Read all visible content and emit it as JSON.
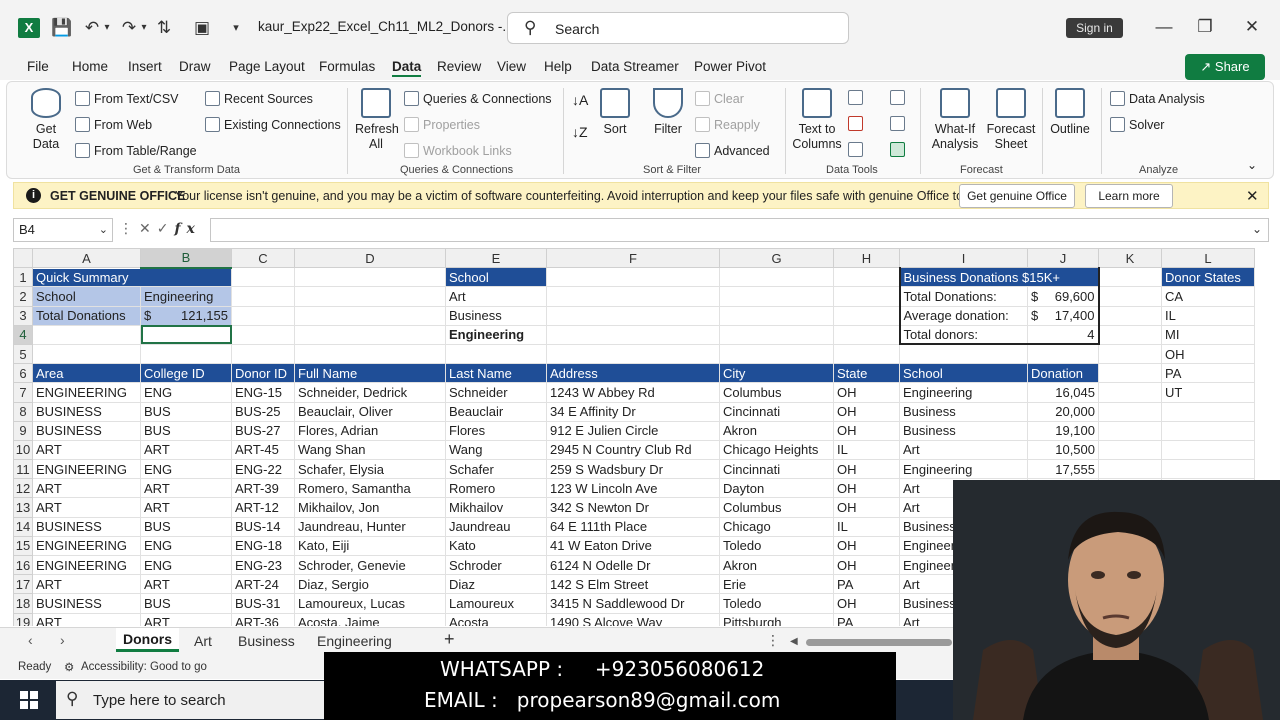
{
  "titlebar": {
    "doc_title": "kaur_Exp22_Excel_Ch11_ML2_Donors  -...",
    "search_label": "Search",
    "signin_label": "Sign in",
    "logo_letter": "X"
  },
  "menu": {
    "tabs": [
      "File",
      "Home",
      "Insert",
      "Draw",
      "Page Layout",
      "Formulas",
      "Data",
      "Review",
      "View",
      "Help",
      "Data Streamer",
      "Power Pivot"
    ],
    "active": "Data",
    "share_label": "Share"
  },
  "ribbon": {
    "get_data": "Get\nData",
    "from_text_csv": "From Text/CSV",
    "from_web": "From Web",
    "from_table_range": "From Table/Range",
    "recent_sources": "Recent Sources",
    "existing_connections": "Existing Connections",
    "group_get_transform": "Get & Transform Data",
    "refresh_all": "Refresh\nAll",
    "queries_connections": "Queries & Connections",
    "properties": "Properties",
    "workbook_links": "Workbook Links",
    "group_queries": "Queries & Connections",
    "sort": "Sort",
    "filter": "Filter",
    "clear": "Clear",
    "reapply": "Reapply",
    "advanced": "Advanced",
    "group_sort_filter": "Sort & Filter",
    "text_to_columns": "Text to\nColumns",
    "group_data_tools": "Data Tools",
    "what_if": "What-If\nAnalysis",
    "forecast_sheet": "Forecast\nSheet",
    "group_forecast": "Forecast",
    "outline": "Outline",
    "data_analysis": "Data Analysis",
    "solver": "Solver",
    "group_analyze": "Analyze"
  },
  "banner": {
    "head": "GET GENUINE OFFICE",
    "message": "Your license isn't genuine, and you may be a victim of software counterfeiting. Avoid interruption and keep your files safe with genuine Office today.",
    "btn_genuine": "Get genuine Office",
    "btn_learn": "Learn more"
  },
  "formula_bar": {
    "name_box": "B4",
    "formula": ""
  },
  "grid": {
    "columns": [
      "A",
      "B",
      "C",
      "D",
      "E",
      "F",
      "G",
      "H",
      "I",
      "J",
      "K",
      "L"
    ],
    "summary": {
      "title": "Quick Summary",
      "school_label": "School",
      "school_value": "Engineering",
      "total_label": "Total Donations",
      "total_currency": "$",
      "total_value": "121,155"
    },
    "school_list": {
      "header": "School",
      "items": [
        "Art",
        "Business",
        "Engineering"
      ]
    },
    "business_box": {
      "title": "Business Donations $15K+",
      "total_label": "Total Donations:",
      "total_currency": "$",
      "total_value": "69,600",
      "avg_label": "Average donation:",
      "avg_currency": "$",
      "avg_value": "17,400",
      "donors_label": "Total donors:",
      "donors_value": "4"
    },
    "donor_states": {
      "header": "Donor States",
      "items": [
        "CA",
        "IL",
        "MI",
        "OH",
        "PA",
        "UT"
      ]
    },
    "table_headers": [
      "Area",
      "College ID",
      "Donor ID",
      "Full Name",
      "Last Name",
      "Address",
      "City",
      "State",
      "School",
      "Donation"
    ],
    "rows": [
      [
        "ENGINEERING",
        "ENG",
        "ENG-15",
        "Schneider, Dedrick",
        "Schneider",
        "1243 W Abbey Rd",
        "Columbus",
        "OH",
        "Engineering",
        "16,045"
      ],
      [
        "BUSINESS",
        "BUS",
        "BUS-25",
        "Beauclair, Oliver",
        "Beauclair",
        "34 E Affinity Dr",
        "Cincinnati",
        "OH",
        "Business",
        "20,000"
      ],
      [
        "BUSINESS",
        "BUS",
        "BUS-27",
        "Flores, Adrian",
        "Flores",
        "912 E Julien Circle",
        "Akron",
        "OH",
        "Business",
        "19,100"
      ],
      [
        "ART",
        "ART",
        "ART-45",
        "Wang  Shan",
        "Wang",
        "2945 N Country Club Rd",
        "Chicago Heights",
        "IL",
        "Art",
        "10,500"
      ],
      [
        "ENGINEERING",
        "ENG",
        "ENG-22",
        "Schafer, Elysia",
        "Schafer",
        "259 S Wadsbury Dr",
        "Cincinnati",
        "OH",
        "Engineering",
        "17,555"
      ],
      [
        "ART",
        "ART",
        "ART-39",
        "Romero, Samantha",
        "Romero",
        "123 W Lincoln Ave",
        "Dayton",
        "OH",
        "Art",
        ""
      ],
      [
        "ART",
        "ART",
        "ART-12",
        "Mikhailov, Jon",
        "Mikhailov",
        "342 S Newton Dr",
        "Columbus",
        "OH",
        "Art",
        ""
      ],
      [
        "BUSINESS",
        "BUS",
        "BUS-14",
        "Jaundreau, Hunter",
        "Jaundreau",
        "64 E 111th Place",
        "Chicago",
        "IL",
        "Business",
        ""
      ],
      [
        "ENGINEERING",
        "ENG",
        "ENG-18",
        "Kato, Eiji",
        "Kato",
        "41 W Eaton Drive",
        "Toledo",
        "OH",
        "Engineer",
        ""
      ],
      [
        "ENGINEERING",
        "ENG",
        "ENG-23",
        "Schroder, Genevie",
        "Schroder",
        "6124 N Odelle Dr",
        "Akron",
        "OH",
        "Engineer",
        ""
      ],
      [
        "ART",
        "ART",
        "ART-24",
        "Diaz, Sergio",
        "Diaz",
        "142 S Elm Street",
        "Erie",
        "PA",
        "Art",
        ""
      ],
      [
        "BUSINESS",
        "BUS",
        "BUS-31",
        "Lamoureux, Lucas",
        "Lamoureux",
        "3415 N Saddlewood Dr",
        "Toledo",
        "OH",
        "Business",
        ""
      ],
      [
        "ART",
        "ART",
        "ART-36",
        "Acosta, Jaime",
        "Acosta",
        "1490 S Alcove Way",
        "Pittsburgh",
        "PA",
        "Art",
        ""
      ]
    ]
  },
  "sheet_tabs": {
    "tabs": [
      "Donors",
      "Art",
      "Business",
      "Engineering"
    ],
    "active": "Donors",
    "add": "+"
  },
  "statusbar": {
    "ready": "Ready",
    "accessibility": "Accessibility: Good to go"
  },
  "taskbar": {
    "search_placeholder": "Type here to search"
  },
  "contact": {
    "line1": "WHATSAPP :     +923056080612",
    "line2": "EMAIL :   propearson89@gmail.com"
  },
  "colors": {
    "excel_green": "#107c41",
    "header_blue": "#1f4e97",
    "light_blue": "#b4c6e7",
    "banner_yellow": "#fdf3c5"
  }
}
